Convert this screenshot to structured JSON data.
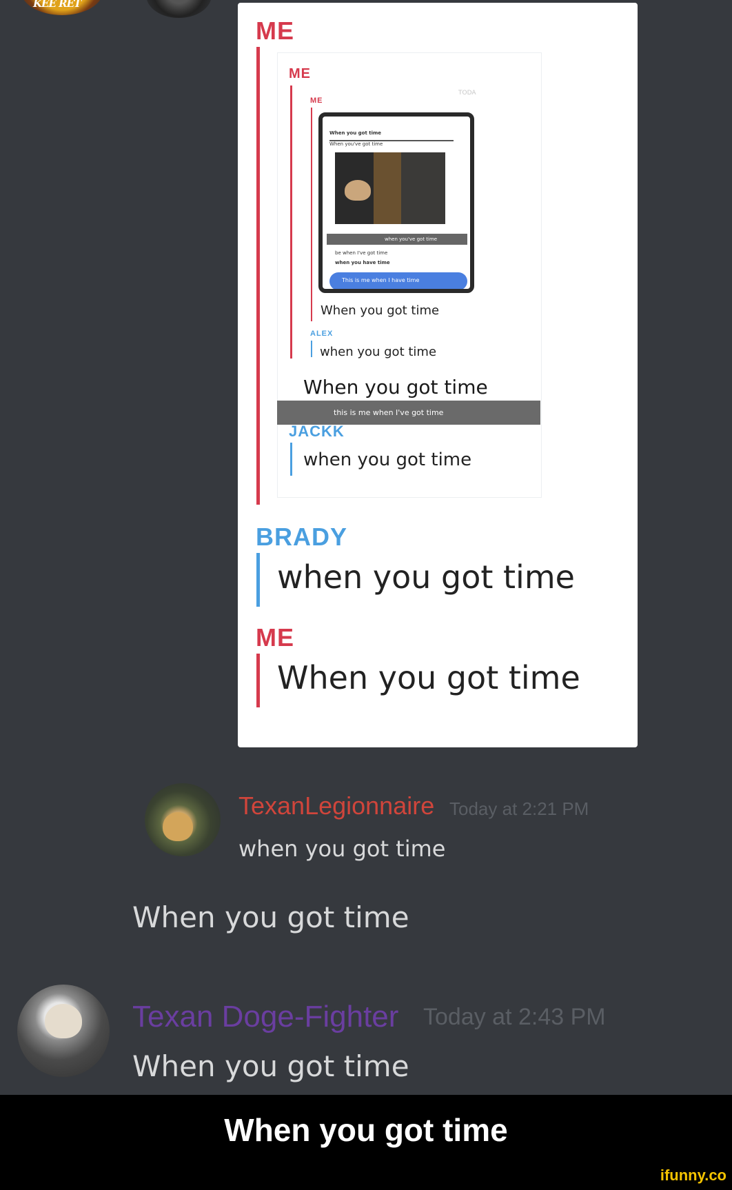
{
  "top_avatar_text": "KEE RET",
  "embedded": {
    "outer_me_label": "ME",
    "inner_me_label": "ME",
    "innermost_me_label": "ME",
    "tiny_today": "TODA",
    "phone": {
      "line1": "When you got time",
      "line2": "When you've got time",
      "greybar_text": "when you've got time",
      "line3": "be when I've got time",
      "line4": "when you have time",
      "pill_text": "This is me when I have time"
    },
    "msg_inner_me": "When you got time",
    "alex_label": "ALEX",
    "alex_msg": "when you got time",
    "msg_mid": "When you got time",
    "gray_caption": "this is me when I've got time",
    "jackk_label": "JACKK",
    "jackk_msg": "when you got time",
    "brady_label": "BRADY",
    "brady_msg": "when you got time",
    "me_label": "ME",
    "me_msg": "When you got time"
  },
  "messages": [
    {
      "username": "TexanLegionnaire",
      "timestamp": "Today at 2:21 PM",
      "lines": [
        "when you got time"
      ],
      "name_color": "#d0453b"
    },
    {
      "username": "",
      "timestamp": "",
      "lines": [
        "When you got time"
      ]
    },
    {
      "username": "Texan Doge-Fighter",
      "timestamp": "Today at 2:43 PM",
      "lines": [
        "When you got time"
      ],
      "name_color": "#6a3ea0"
    }
  ],
  "caption": "When you got time",
  "watermark": "ifunny.co"
}
